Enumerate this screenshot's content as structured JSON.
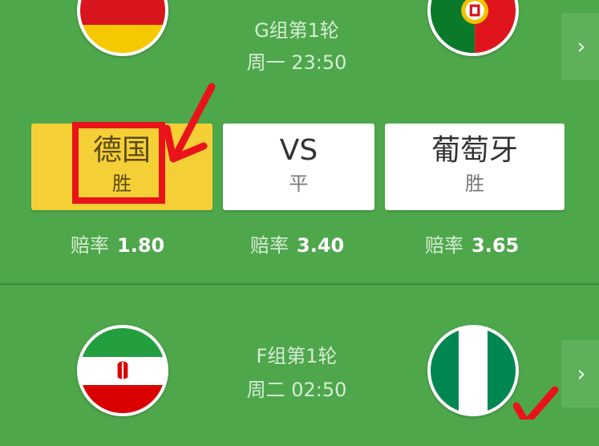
{
  "match1": {
    "home_team": "德国",
    "away_team": "葡萄牙",
    "round": "G组第1轮",
    "time": "周一 23:50",
    "options": {
      "home": {
        "name": "德国",
        "sub": "胜",
        "selected": true
      },
      "draw": {
        "name": "VS",
        "sub": "平",
        "selected": false
      },
      "away": {
        "name": "葡萄牙",
        "sub": "胜",
        "selected": false
      }
    },
    "odds": {
      "label": "赔率",
      "home": "1.80",
      "draw": "3.40",
      "away": "3.65"
    },
    "next_icon": "chevron-right-icon"
  },
  "match2": {
    "round": "F组第1轮",
    "time": "周二 02:50",
    "next_icon": "chevron-right-icon"
  },
  "colors": {
    "background": "#4ea74b",
    "selected": "#f5cf36",
    "annotation": "#e8141a"
  }
}
